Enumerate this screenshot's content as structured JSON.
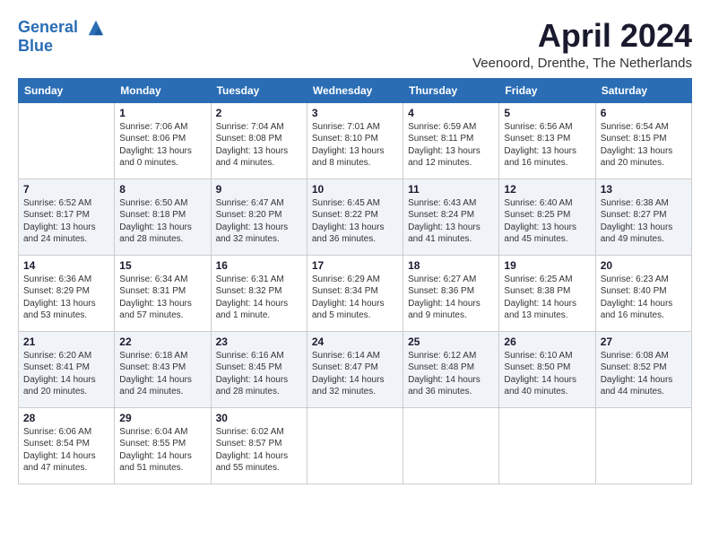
{
  "header": {
    "logo_line1": "General",
    "logo_line2": "Blue",
    "month_title": "April 2024",
    "location": "Veenoord, Drenthe, The Netherlands"
  },
  "days_of_week": [
    "Sunday",
    "Monday",
    "Tuesday",
    "Wednesday",
    "Thursday",
    "Friday",
    "Saturday"
  ],
  "weeks": [
    [
      {
        "day": "",
        "sunrise": "",
        "sunset": "",
        "daylight": ""
      },
      {
        "day": "1",
        "sunrise": "Sunrise: 7:06 AM",
        "sunset": "Sunset: 8:06 PM",
        "daylight": "Daylight: 13 hours and 0 minutes."
      },
      {
        "day": "2",
        "sunrise": "Sunrise: 7:04 AM",
        "sunset": "Sunset: 8:08 PM",
        "daylight": "Daylight: 13 hours and 4 minutes."
      },
      {
        "day": "3",
        "sunrise": "Sunrise: 7:01 AM",
        "sunset": "Sunset: 8:10 PM",
        "daylight": "Daylight: 13 hours and 8 minutes."
      },
      {
        "day": "4",
        "sunrise": "Sunrise: 6:59 AM",
        "sunset": "Sunset: 8:11 PM",
        "daylight": "Daylight: 13 hours and 12 minutes."
      },
      {
        "day": "5",
        "sunrise": "Sunrise: 6:56 AM",
        "sunset": "Sunset: 8:13 PM",
        "daylight": "Daylight: 13 hours and 16 minutes."
      },
      {
        "day": "6",
        "sunrise": "Sunrise: 6:54 AM",
        "sunset": "Sunset: 8:15 PM",
        "daylight": "Daylight: 13 hours and 20 minutes."
      }
    ],
    [
      {
        "day": "7",
        "sunrise": "Sunrise: 6:52 AM",
        "sunset": "Sunset: 8:17 PM",
        "daylight": "Daylight: 13 hours and 24 minutes."
      },
      {
        "day": "8",
        "sunrise": "Sunrise: 6:50 AM",
        "sunset": "Sunset: 8:18 PM",
        "daylight": "Daylight: 13 hours and 28 minutes."
      },
      {
        "day": "9",
        "sunrise": "Sunrise: 6:47 AM",
        "sunset": "Sunset: 8:20 PM",
        "daylight": "Daylight: 13 hours and 32 minutes."
      },
      {
        "day": "10",
        "sunrise": "Sunrise: 6:45 AM",
        "sunset": "Sunset: 8:22 PM",
        "daylight": "Daylight: 13 hours and 36 minutes."
      },
      {
        "day": "11",
        "sunrise": "Sunrise: 6:43 AM",
        "sunset": "Sunset: 8:24 PM",
        "daylight": "Daylight: 13 hours and 41 minutes."
      },
      {
        "day": "12",
        "sunrise": "Sunrise: 6:40 AM",
        "sunset": "Sunset: 8:25 PM",
        "daylight": "Daylight: 13 hours and 45 minutes."
      },
      {
        "day": "13",
        "sunrise": "Sunrise: 6:38 AM",
        "sunset": "Sunset: 8:27 PM",
        "daylight": "Daylight: 13 hours and 49 minutes."
      }
    ],
    [
      {
        "day": "14",
        "sunrise": "Sunrise: 6:36 AM",
        "sunset": "Sunset: 8:29 PM",
        "daylight": "Daylight: 13 hours and 53 minutes."
      },
      {
        "day": "15",
        "sunrise": "Sunrise: 6:34 AM",
        "sunset": "Sunset: 8:31 PM",
        "daylight": "Daylight: 13 hours and 57 minutes."
      },
      {
        "day": "16",
        "sunrise": "Sunrise: 6:31 AM",
        "sunset": "Sunset: 8:32 PM",
        "daylight": "Daylight: 14 hours and 1 minute."
      },
      {
        "day": "17",
        "sunrise": "Sunrise: 6:29 AM",
        "sunset": "Sunset: 8:34 PM",
        "daylight": "Daylight: 14 hours and 5 minutes."
      },
      {
        "day": "18",
        "sunrise": "Sunrise: 6:27 AM",
        "sunset": "Sunset: 8:36 PM",
        "daylight": "Daylight: 14 hours and 9 minutes."
      },
      {
        "day": "19",
        "sunrise": "Sunrise: 6:25 AM",
        "sunset": "Sunset: 8:38 PM",
        "daylight": "Daylight: 14 hours and 13 minutes."
      },
      {
        "day": "20",
        "sunrise": "Sunrise: 6:23 AM",
        "sunset": "Sunset: 8:40 PM",
        "daylight": "Daylight: 14 hours and 16 minutes."
      }
    ],
    [
      {
        "day": "21",
        "sunrise": "Sunrise: 6:20 AM",
        "sunset": "Sunset: 8:41 PM",
        "daylight": "Daylight: 14 hours and 20 minutes."
      },
      {
        "day": "22",
        "sunrise": "Sunrise: 6:18 AM",
        "sunset": "Sunset: 8:43 PM",
        "daylight": "Daylight: 14 hours and 24 minutes."
      },
      {
        "day": "23",
        "sunrise": "Sunrise: 6:16 AM",
        "sunset": "Sunset: 8:45 PM",
        "daylight": "Daylight: 14 hours and 28 minutes."
      },
      {
        "day": "24",
        "sunrise": "Sunrise: 6:14 AM",
        "sunset": "Sunset: 8:47 PM",
        "daylight": "Daylight: 14 hours and 32 minutes."
      },
      {
        "day": "25",
        "sunrise": "Sunrise: 6:12 AM",
        "sunset": "Sunset: 8:48 PM",
        "daylight": "Daylight: 14 hours and 36 minutes."
      },
      {
        "day": "26",
        "sunrise": "Sunrise: 6:10 AM",
        "sunset": "Sunset: 8:50 PM",
        "daylight": "Daylight: 14 hours and 40 minutes."
      },
      {
        "day": "27",
        "sunrise": "Sunrise: 6:08 AM",
        "sunset": "Sunset: 8:52 PM",
        "daylight": "Daylight: 14 hours and 44 minutes."
      }
    ],
    [
      {
        "day": "28",
        "sunrise": "Sunrise: 6:06 AM",
        "sunset": "Sunset: 8:54 PM",
        "daylight": "Daylight: 14 hours and 47 minutes."
      },
      {
        "day": "29",
        "sunrise": "Sunrise: 6:04 AM",
        "sunset": "Sunset: 8:55 PM",
        "daylight": "Daylight: 14 hours and 51 minutes."
      },
      {
        "day": "30",
        "sunrise": "Sunrise: 6:02 AM",
        "sunset": "Sunset: 8:57 PM",
        "daylight": "Daylight: 14 hours and 55 minutes."
      },
      {
        "day": "",
        "sunrise": "",
        "sunset": "",
        "daylight": ""
      },
      {
        "day": "",
        "sunrise": "",
        "sunset": "",
        "daylight": ""
      },
      {
        "day": "",
        "sunrise": "",
        "sunset": "",
        "daylight": ""
      },
      {
        "day": "",
        "sunrise": "",
        "sunset": "",
        "daylight": ""
      }
    ]
  ]
}
